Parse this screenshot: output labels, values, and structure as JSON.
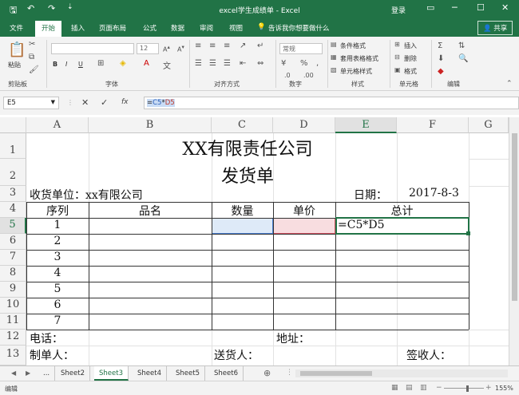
{
  "title_bar": {
    "title": "excel学生成绩单 - Excel",
    "login": "登录",
    "save_icon": "save-icon",
    "undo_icon": "undo-icon",
    "redo_icon": "redo-icon"
  },
  "tabs": [
    "文件",
    "开始",
    "插入",
    "页面布局",
    "公式",
    "数据",
    "审阅",
    "视图"
  ],
  "active_tab": "开始",
  "tell_me": "告诉我你想要做什么",
  "share": "共享",
  "ribbon": {
    "paste": "粘贴",
    "groups": [
      "剪贴板",
      "字体",
      "对齐方式",
      "数字",
      "样式",
      "单元格",
      "编辑"
    ],
    "font_size": "12",
    "number_format": "常规",
    "styles": [
      "条件格式",
      "套用表格格式",
      "单元格样式"
    ],
    "cells": [
      "插入",
      "删除",
      "格式"
    ],
    "bold": "B",
    "italic": "I",
    "underline": "U"
  },
  "formula_bar": {
    "name_box": "E5",
    "formula_prefix": "=",
    "formula_ref1": "C5",
    "formula_op": "*",
    "formula_ref2": "D5",
    "fx": "fx"
  },
  "columns": [
    "A",
    "B",
    "C",
    "D",
    "E",
    "F",
    "G"
  ],
  "rows": [
    "1",
    "2",
    "3",
    "4",
    "5",
    "6",
    "7",
    "8",
    "9",
    "10",
    "11",
    "12",
    "13"
  ],
  "sheet_content": {
    "company": "XX有限责任公司",
    "doc_title": "发货单",
    "receiver_label": "收货单位：xx有限公司",
    "date_label": "日期：",
    "date_value": "2017-8-3",
    "headers": [
      "序列",
      "品名",
      "数量",
      "单价",
      "总计"
    ],
    "seq": [
      "1",
      "2",
      "3",
      "4",
      "5",
      "6",
      "7"
    ],
    "active_formula": "=C5*D5",
    "phone": "电话：",
    "address": "地址：",
    "maker": "制单人：",
    "deliverer": "送货人：",
    "signer": "签收人："
  },
  "sheet_tabs": [
    "...",
    "Sheet2",
    "Sheet3",
    "Sheet4",
    "Sheet5",
    "Sheet6"
  ],
  "active_sheet": "Sheet3",
  "status": {
    "mode": "编辑",
    "zoom": "155%"
  }
}
